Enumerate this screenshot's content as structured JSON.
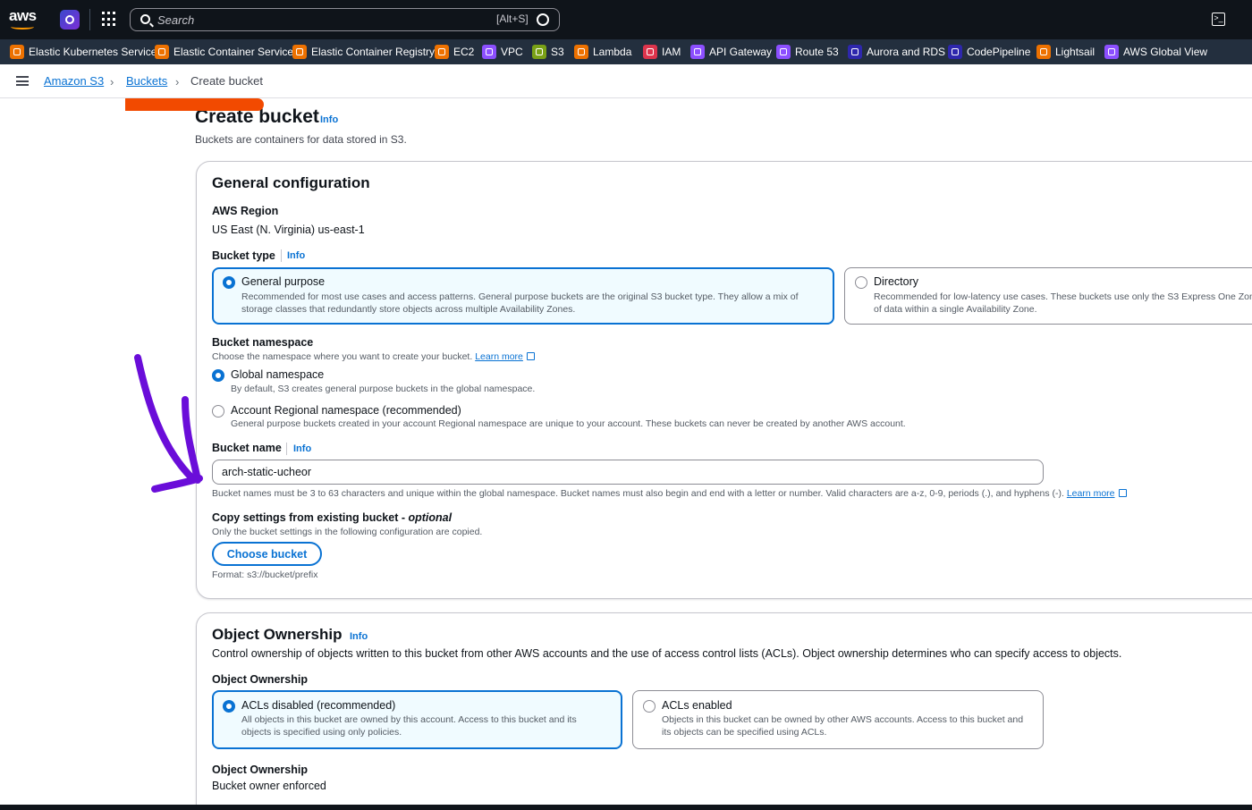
{
  "topnav": {
    "logo_text": "aws",
    "search_placeholder": "Search",
    "search_hint": "[Alt+S]",
    "cloudshell_glyph": ">_"
  },
  "favorites": [
    {
      "label": "Elastic Kubernetes Service",
      "color": "#ed7100"
    },
    {
      "label": "Elastic Container Service",
      "color": "#ed7100"
    },
    {
      "label": "Elastic Container Registry",
      "color": "#ed7100"
    },
    {
      "label": "EC2",
      "color": "#ed7100"
    },
    {
      "label": "VPC",
      "color": "#8c4fff"
    },
    {
      "label": "S3",
      "color": "#7aa116"
    },
    {
      "label": "Lambda",
      "color": "#ed7100"
    },
    {
      "label": "IAM",
      "color": "#dd344c"
    },
    {
      "label": "API Gateway",
      "color": "#8c4fff"
    },
    {
      "label": "Route 53",
      "color": "#8c4fff"
    },
    {
      "label": "Aurora and RDS",
      "color": "#2e27ad"
    },
    {
      "label": "CodePipeline",
      "color": "#2e27ad"
    },
    {
      "label": "Lightsail",
      "color": "#ed7100"
    },
    {
      "label": "AWS Global View",
      "color": "#8c4fff"
    }
  ],
  "breadcrumb": {
    "items": [
      "Amazon S3",
      "Buckets",
      "Create bucket"
    ]
  },
  "header": {
    "title": "Create bucket",
    "info": "Info",
    "description": "Buckets are containers for data stored in S3."
  },
  "general": {
    "title": "General configuration",
    "region_label": "AWS Region",
    "region_value": "US East (N. Virginia) us-east-1",
    "bucket_type_label": "Bucket type",
    "bucket_type_info": "Info",
    "types": [
      {
        "title": "General purpose",
        "desc": "Recommended for most use cases and access patterns. General purpose buckets are the original S3 bucket type. They allow a mix of storage classes that redundantly store objects across multiple Availability Zones.",
        "selected": true
      },
      {
        "title": "Directory",
        "desc": "Recommended for low-latency use cases. These buckets use only the S3 Express One Zone storage class, which provides faster processing of data within a single Availability Zone.",
        "selected": false
      }
    ],
    "namespace_label": "Bucket namespace",
    "namespace_desc": "Choose the namespace where you want to create your bucket.",
    "learn_more": "Learn more",
    "namespaces": [
      {
        "title": "Global namespace",
        "desc": "By default, S3 creates general purpose buckets in the global namespace.",
        "selected": true
      },
      {
        "title": "Account Regional namespace (recommended)",
        "desc": "General purpose buckets created in your account Regional namespace are unique to your account. These buckets can never be created by another AWS account.",
        "selected": false
      }
    ],
    "name_label": "Bucket name",
    "name_info": "Info",
    "name_value": "arch-static-ucheor",
    "name_hint": "Bucket names must be 3 to 63 characters and unique within the global namespace. Bucket names must also begin and end with a letter or number. Valid characters are a-z, 0-9, periods (.), and hyphens (-).",
    "copy_label": "Copy settings from existing bucket - ",
    "copy_optional": "optional",
    "copy_desc": "Only the bucket settings in the following configuration are copied.",
    "choose_button": "Choose bucket",
    "format_hint": "Format: s3://bucket/prefix"
  },
  "ownership": {
    "title": "Object Ownership",
    "info": "Info",
    "description": "Control ownership of objects written to this bucket from other AWS accounts and the use of access control lists (ACLs). Object ownership determines who can specify access to objects.",
    "label": "Object Ownership",
    "options": [
      {
        "title": "ACLs disabled (recommended)",
        "desc": "All objects in this bucket are owned by this account. Access to this bucket and its objects is specified using only policies.",
        "selected": true
      },
      {
        "title": "ACLs enabled",
        "desc": "Objects in this bucket can be owned by other AWS accounts. Access to this bucket and its objects can be specified using ACLs.",
        "selected": false
      }
    ],
    "result_label": "Object Ownership",
    "result_value": "Bucket owner enforced"
  }
}
